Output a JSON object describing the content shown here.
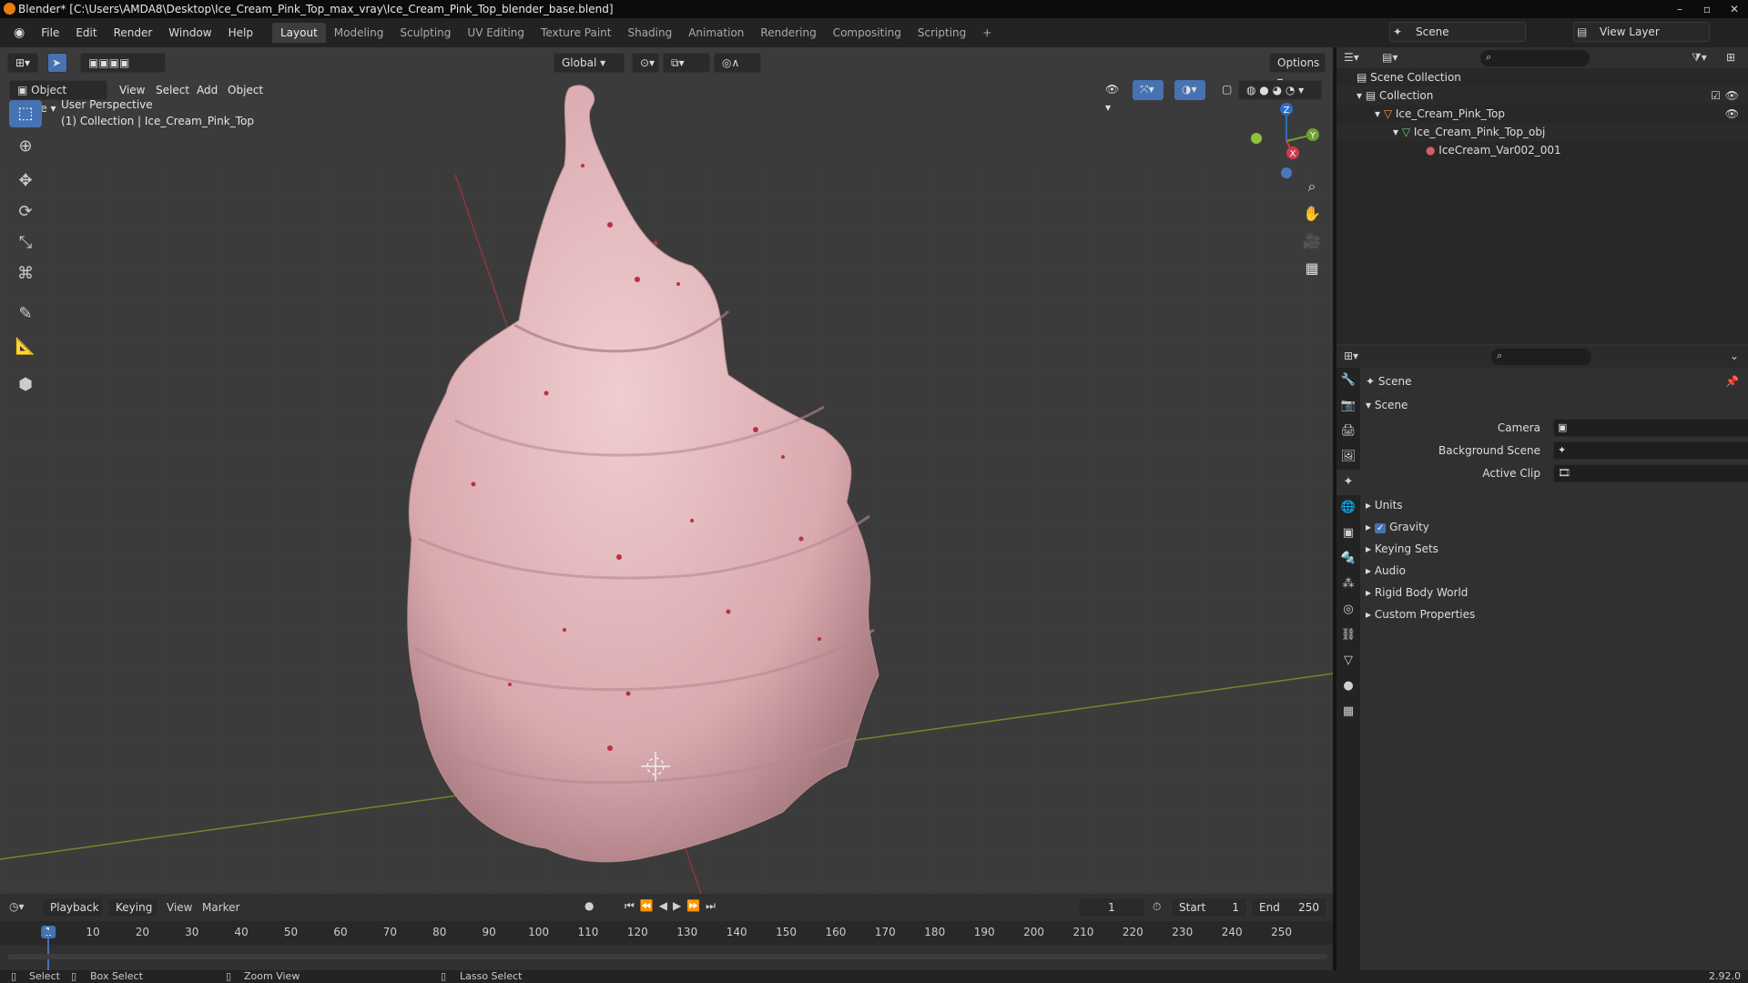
{
  "window": {
    "title": "Blender* [C:\\Users\\AMDA8\\Desktop\\Ice_Cream_Pink_Top_max_vray\\Ice_Cream_Pink_Top_blender_base.blend]",
    "controls": [
      "–",
      "▫",
      "✕"
    ]
  },
  "menu": [
    "File",
    "Edit",
    "Render",
    "Window",
    "Help"
  ],
  "workspaces": [
    {
      "label": "Layout",
      "active": true
    },
    {
      "label": "Modeling"
    },
    {
      "label": "Sculpting"
    },
    {
      "label": "UV Editing"
    },
    {
      "label": "Texture Paint"
    },
    {
      "label": "Shading"
    },
    {
      "label": "Animation"
    },
    {
      "label": "Rendering"
    },
    {
      "label": "Compositing"
    },
    {
      "label": "Scripting"
    }
  ],
  "add_workspace": "+",
  "scene_selector": "Scene",
  "view_layer": "View Layer",
  "viewport": {
    "mode": "Object Mode",
    "header_menus": [
      "View",
      "Select",
      "Add",
      "Object"
    ],
    "orientation": "Global",
    "options": "Options",
    "overlay_title": "User Perspective",
    "overlay_sub": "(1) Collection | Ice_Cream_Pink_Top",
    "gizmo": {
      "x": "X",
      "y": "Y",
      "z": "Z"
    }
  },
  "outliner": {
    "root": "Scene Collection",
    "items": [
      {
        "label": "Collection",
        "level": 1
      },
      {
        "label": "Ice_Cream_Pink_Top",
        "level": 2
      },
      {
        "label": "Ice_Cream_Pink_Top_obj",
        "level": 3
      },
      {
        "label": "IceCream_Var002_001",
        "level": 4
      }
    ]
  },
  "properties": {
    "context": "Scene",
    "panel": "Scene",
    "fields": [
      {
        "label": "Camera"
      },
      {
        "label": "Background Scene"
      },
      {
        "label": "Active Clip"
      }
    ],
    "sections": [
      "Units",
      "Gravity",
      "Keying Sets",
      "Audio",
      "Rigid Body World",
      "Custom Properties"
    ],
    "gravity_checked": true
  },
  "timeline": {
    "menus": [
      "Playback",
      "Keying",
      "View",
      "Marker"
    ],
    "current_frame": "1",
    "start_label": "Start",
    "start": "1",
    "end_label": "End",
    "end": "250",
    "ruler": [
      "1",
      "10",
      "20",
      "30",
      "40",
      "50",
      "60",
      "70",
      "80",
      "90",
      "100",
      "110",
      "120",
      "130",
      "140",
      "150",
      "160",
      "170",
      "180",
      "190",
      "200",
      "210",
      "220",
      "230",
      "240",
      "250"
    ]
  },
  "status": {
    "items": [
      "Select",
      "Box Select",
      "Zoom View",
      "Lasso Select"
    ],
    "version": "2.92.0"
  }
}
